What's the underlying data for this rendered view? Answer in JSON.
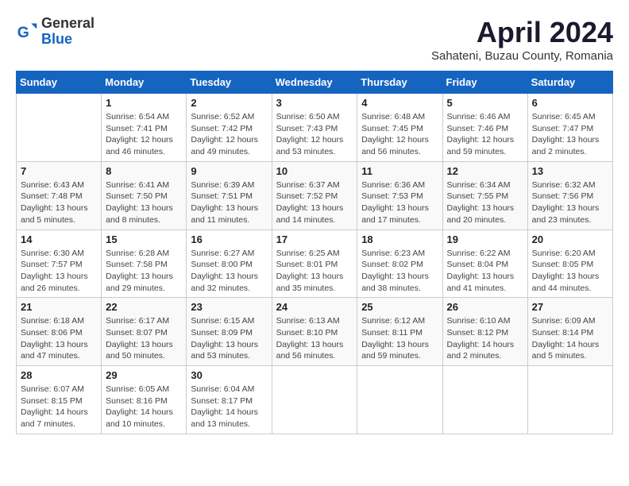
{
  "header": {
    "logo_general": "General",
    "logo_blue": "Blue",
    "month_title": "April 2024",
    "subtitle": "Sahateni, Buzau County, Romania"
  },
  "weekdays": [
    "Sunday",
    "Monday",
    "Tuesday",
    "Wednesday",
    "Thursday",
    "Friday",
    "Saturday"
  ],
  "weeks": [
    [
      {
        "day": "",
        "details": ""
      },
      {
        "day": "1",
        "details": "Sunrise: 6:54 AM\nSunset: 7:41 PM\nDaylight: 12 hours\nand 46 minutes."
      },
      {
        "day": "2",
        "details": "Sunrise: 6:52 AM\nSunset: 7:42 PM\nDaylight: 12 hours\nand 49 minutes."
      },
      {
        "day": "3",
        "details": "Sunrise: 6:50 AM\nSunset: 7:43 PM\nDaylight: 12 hours\nand 53 minutes."
      },
      {
        "day": "4",
        "details": "Sunrise: 6:48 AM\nSunset: 7:45 PM\nDaylight: 12 hours\nand 56 minutes."
      },
      {
        "day": "5",
        "details": "Sunrise: 6:46 AM\nSunset: 7:46 PM\nDaylight: 12 hours\nand 59 minutes."
      },
      {
        "day": "6",
        "details": "Sunrise: 6:45 AM\nSunset: 7:47 PM\nDaylight: 13 hours\nand 2 minutes."
      }
    ],
    [
      {
        "day": "7",
        "details": "Sunrise: 6:43 AM\nSunset: 7:48 PM\nDaylight: 13 hours\nand 5 minutes."
      },
      {
        "day": "8",
        "details": "Sunrise: 6:41 AM\nSunset: 7:50 PM\nDaylight: 13 hours\nand 8 minutes."
      },
      {
        "day": "9",
        "details": "Sunrise: 6:39 AM\nSunset: 7:51 PM\nDaylight: 13 hours\nand 11 minutes."
      },
      {
        "day": "10",
        "details": "Sunrise: 6:37 AM\nSunset: 7:52 PM\nDaylight: 13 hours\nand 14 minutes."
      },
      {
        "day": "11",
        "details": "Sunrise: 6:36 AM\nSunset: 7:53 PM\nDaylight: 13 hours\nand 17 minutes."
      },
      {
        "day": "12",
        "details": "Sunrise: 6:34 AM\nSunset: 7:55 PM\nDaylight: 13 hours\nand 20 minutes."
      },
      {
        "day": "13",
        "details": "Sunrise: 6:32 AM\nSunset: 7:56 PM\nDaylight: 13 hours\nand 23 minutes."
      }
    ],
    [
      {
        "day": "14",
        "details": "Sunrise: 6:30 AM\nSunset: 7:57 PM\nDaylight: 13 hours\nand 26 minutes."
      },
      {
        "day": "15",
        "details": "Sunrise: 6:28 AM\nSunset: 7:58 PM\nDaylight: 13 hours\nand 29 minutes."
      },
      {
        "day": "16",
        "details": "Sunrise: 6:27 AM\nSunset: 8:00 PM\nDaylight: 13 hours\nand 32 minutes."
      },
      {
        "day": "17",
        "details": "Sunrise: 6:25 AM\nSunset: 8:01 PM\nDaylight: 13 hours\nand 35 minutes."
      },
      {
        "day": "18",
        "details": "Sunrise: 6:23 AM\nSunset: 8:02 PM\nDaylight: 13 hours\nand 38 minutes."
      },
      {
        "day": "19",
        "details": "Sunrise: 6:22 AM\nSunset: 8:04 PM\nDaylight: 13 hours\nand 41 minutes."
      },
      {
        "day": "20",
        "details": "Sunrise: 6:20 AM\nSunset: 8:05 PM\nDaylight: 13 hours\nand 44 minutes."
      }
    ],
    [
      {
        "day": "21",
        "details": "Sunrise: 6:18 AM\nSunset: 8:06 PM\nDaylight: 13 hours\nand 47 minutes."
      },
      {
        "day": "22",
        "details": "Sunrise: 6:17 AM\nSunset: 8:07 PM\nDaylight: 13 hours\nand 50 minutes."
      },
      {
        "day": "23",
        "details": "Sunrise: 6:15 AM\nSunset: 8:09 PM\nDaylight: 13 hours\nand 53 minutes."
      },
      {
        "day": "24",
        "details": "Sunrise: 6:13 AM\nSunset: 8:10 PM\nDaylight: 13 hours\nand 56 minutes."
      },
      {
        "day": "25",
        "details": "Sunrise: 6:12 AM\nSunset: 8:11 PM\nDaylight: 13 hours\nand 59 minutes."
      },
      {
        "day": "26",
        "details": "Sunrise: 6:10 AM\nSunset: 8:12 PM\nDaylight: 14 hours\nand 2 minutes."
      },
      {
        "day": "27",
        "details": "Sunrise: 6:09 AM\nSunset: 8:14 PM\nDaylight: 14 hours\nand 5 minutes."
      }
    ],
    [
      {
        "day": "28",
        "details": "Sunrise: 6:07 AM\nSunset: 8:15 PM\nDaylight: 14 hours\nand 7 minutes."
      },
      {
        "day": "29",
        "details": "Sunrise: 6:05 AM\nSunset: 8:16 PM\nDaylight: 14 hours\nand 10 minutes."
      },
      {
        "day": "30",
        "details": "Sunrise: 6:04 AM\nSunset: 8:17 PM\nDaylight: 14 hours\nand 13 minutes."
      },
      {
        "day": "",
        "details": ""
      },
      {
        "day": "",
        "details": ""
      },
      {
        "day": "",
        "details": ""
      },
      {
        "day": "",
        "details": ""
      }
    ]
  ]
}
